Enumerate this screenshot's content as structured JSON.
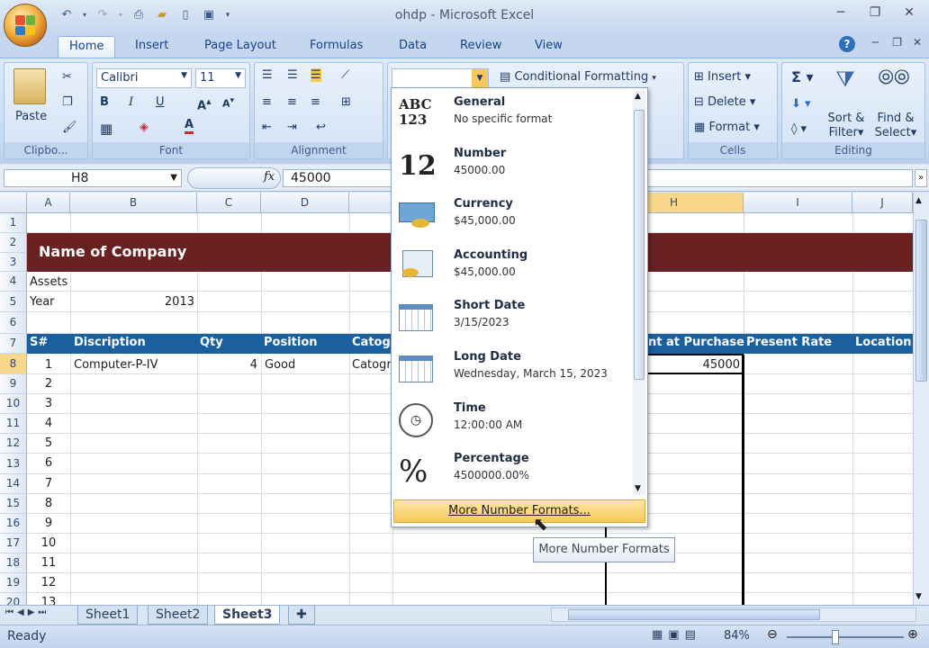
{
  "window": {
    "title": "ohdp - Microsoft Excel"
  },
  "tabs": [
    "Home",
    "Insert",
    "Page Layout",
    "Formulas",
    "Data",
    "Review",
    "View"
  ],
  "ribbon": {
    "clipboard": {
      "paste": "Paste",
      "label": "Clipbo..."
    },
    "font": {
      "name": "Calibri",
      "size": "11",
      "label": "Font"
    },
    "alignment": {
      "label": "Alignment"
    },
    "styles": {
      "conditional_formatting": "Conditional Formatting"
    },
    "cells": {
      "insert": "Insert",
      "delete": "Delete",
      "format": "Format",
      "label": "Cells"
    },
    "editing": {
      "sort_filter_1": "Sort &",
      "sort_filter_2": "Filter",
      "find_select_1": "Find &",
      "find_select_2": "Select",
      "label": "Editing"
    }
  },
  "formula_bar": {
    "name_box": "H8",
    "fx": "fx",
    "value": "45000"
  },
  "columns": [
    "A",
    "B",
    "C",
    "D",
    "H",
    "I",
    "J"
  ],
  "rows": [
    "1",
    "2",
    "3",
    "4",
    "5",
    "6",
    "7",
    "8",
    "9",
    "10",
    "11",
    "12",
    "13",
    "14",
    "15",
    "16",
    "17",
    "18",
    "19",
    "20"
  ],
  "sheet": {
    "company": "Name of Company",
    "assets": "Assets",
    "year_label": "Year",
    "year_value": "2013",
    "headers": {
      "sn": "S#",
      "description": "Discription",
      "qty": "Qty",
      "position": "Position",
      "category": "Catogr",
      "purchase": "nt at Purchase",
      "present_rate": "Present Rate",
      "location": "Location"
    },
    "row8": {
      "sn": "1",
      "description": "Computer-P-IV",
      "qty": "4",
      "position": "Good",
      "category": "Catogr",
      "amount": "45000"
    },
    "sn_values": [
      "2",
      "3",
      "4",
      "5",
      "6",
      "7",
      "8",
      "9",
      "10",
      "11",
      "12",
      "13"
    ]
  },
  "number_formats": [
    {
      "name": "General",
      "example": "No specific format",
      "icon": "abc-123-icon"
    },
    {
      "name": "Number",
      "example": "45000.00",
      "icon": "number-12-icon"
    },
    {
      "name": "Currency",
      "example": "$45,000.00",
      "icon": "currency-icon"
    },
    {
      "name": "Accounting",
      "example": " $45,000.00",
      "icon": "accounting-icon"
    },
    {
      "name": "Short Date",
      "example": "3/15/2023",
      "icon": "calendar-icon"
    },
    {
      "name": "Long Date",
      "example": "Wednesday, March 15, 2023",
      "icon": "calendar-icon"
    },
    {
      "name": "Time",
      "example": "12:00:00 AM",
      "icon": "clock-icon"
    },
    {
      "name": "Percentage",
      "example": "4500000.00%",
      "icon": "percent-icon"
    }
  ],
  "more_formats": "More Number Formats...",
  "tooltip": "More Number Formats",
  "sheet_tabs": [
    "Sheet1",
    "Sheet2",
    "Sheet3"
  ],
  "status": {
    "ready": "Ready",
    "zoom": "84%"
  }
}
